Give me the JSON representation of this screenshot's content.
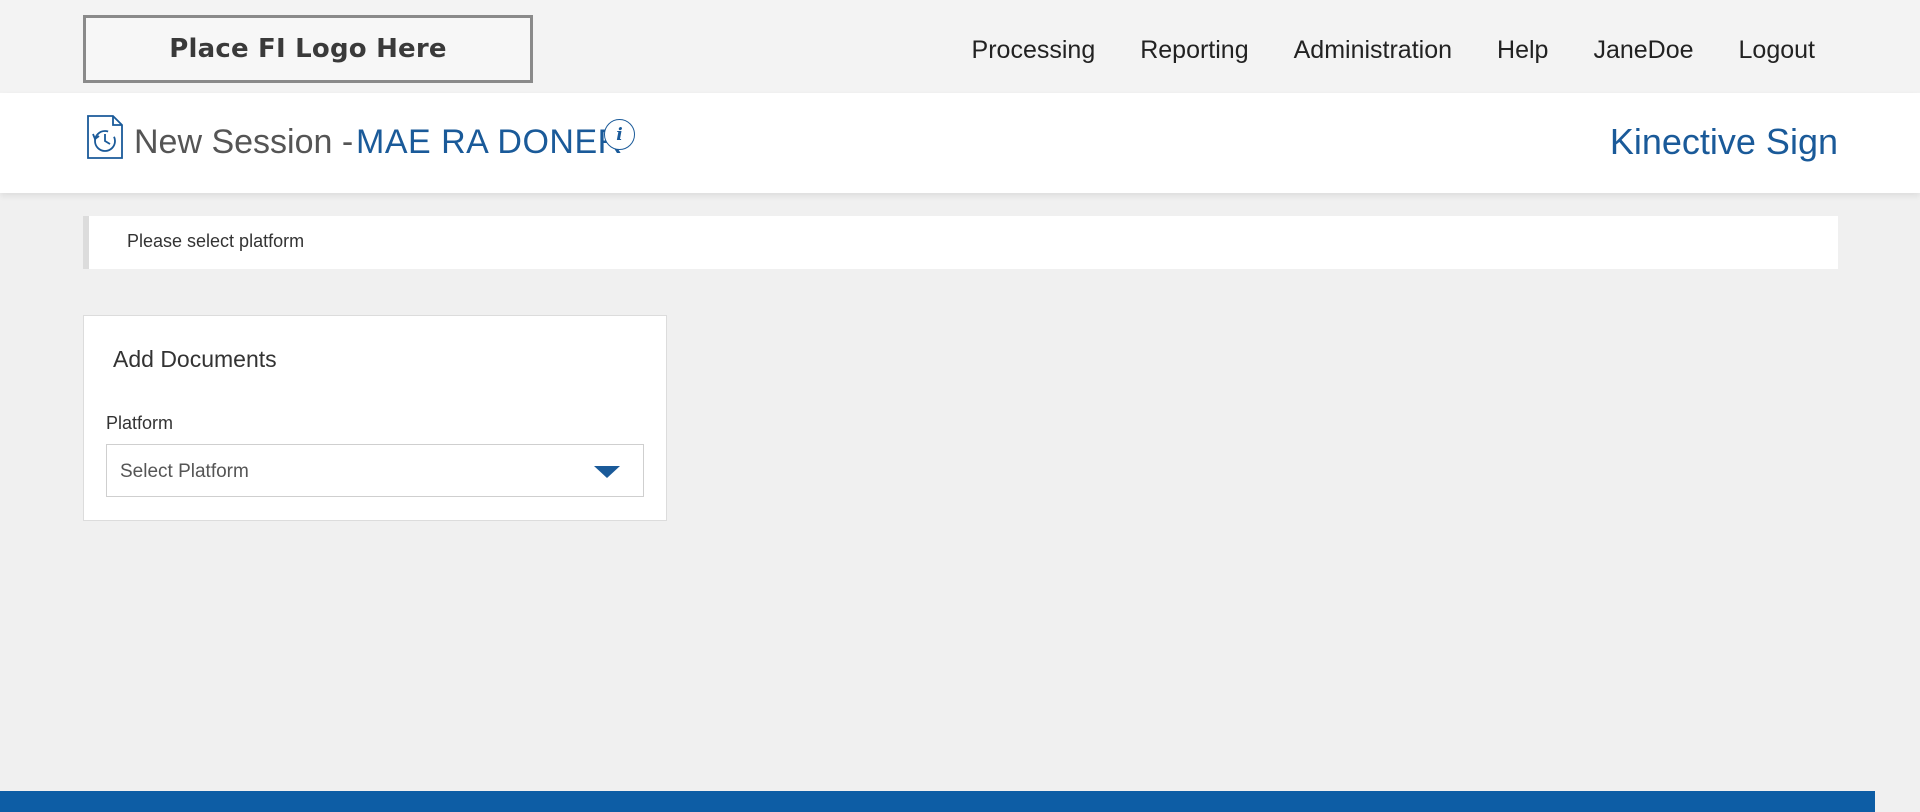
{
  "header": {
    "logo_text": "Place FI Logo Here",
    "nav": [
      {
        "label": "Processing"
      },
      {
        "label": "Reporting"
      },
      {
        "label": "Administration"
      },
      {
        "label": "Help"
      },
      {
        "label": "JaneDoe"
      },
      {
        "label": "Logout"
      }
    ]
  },
  "session": {
    "title": "New Session -",
    "name": "MAE RA DONER",
    "info_icon": "info-icon",
    "history_icon": "document-history-icon",
    "brand": "Kinective Sign"
  },
  "alert": {
    "text": "Please select platform"
  },
  "add_documents": {
    "title": "Add Documents",
    "platform_label": "Platform",
    "platform_value": "Select Platform",
    "dropdown_icon": "chevron-down-icon"
  },
  "colors": {
    "accent": "#1a5a99",
    "footer": "#0d5da5",
    "page_background": "#f0f0f0"
  }
}
